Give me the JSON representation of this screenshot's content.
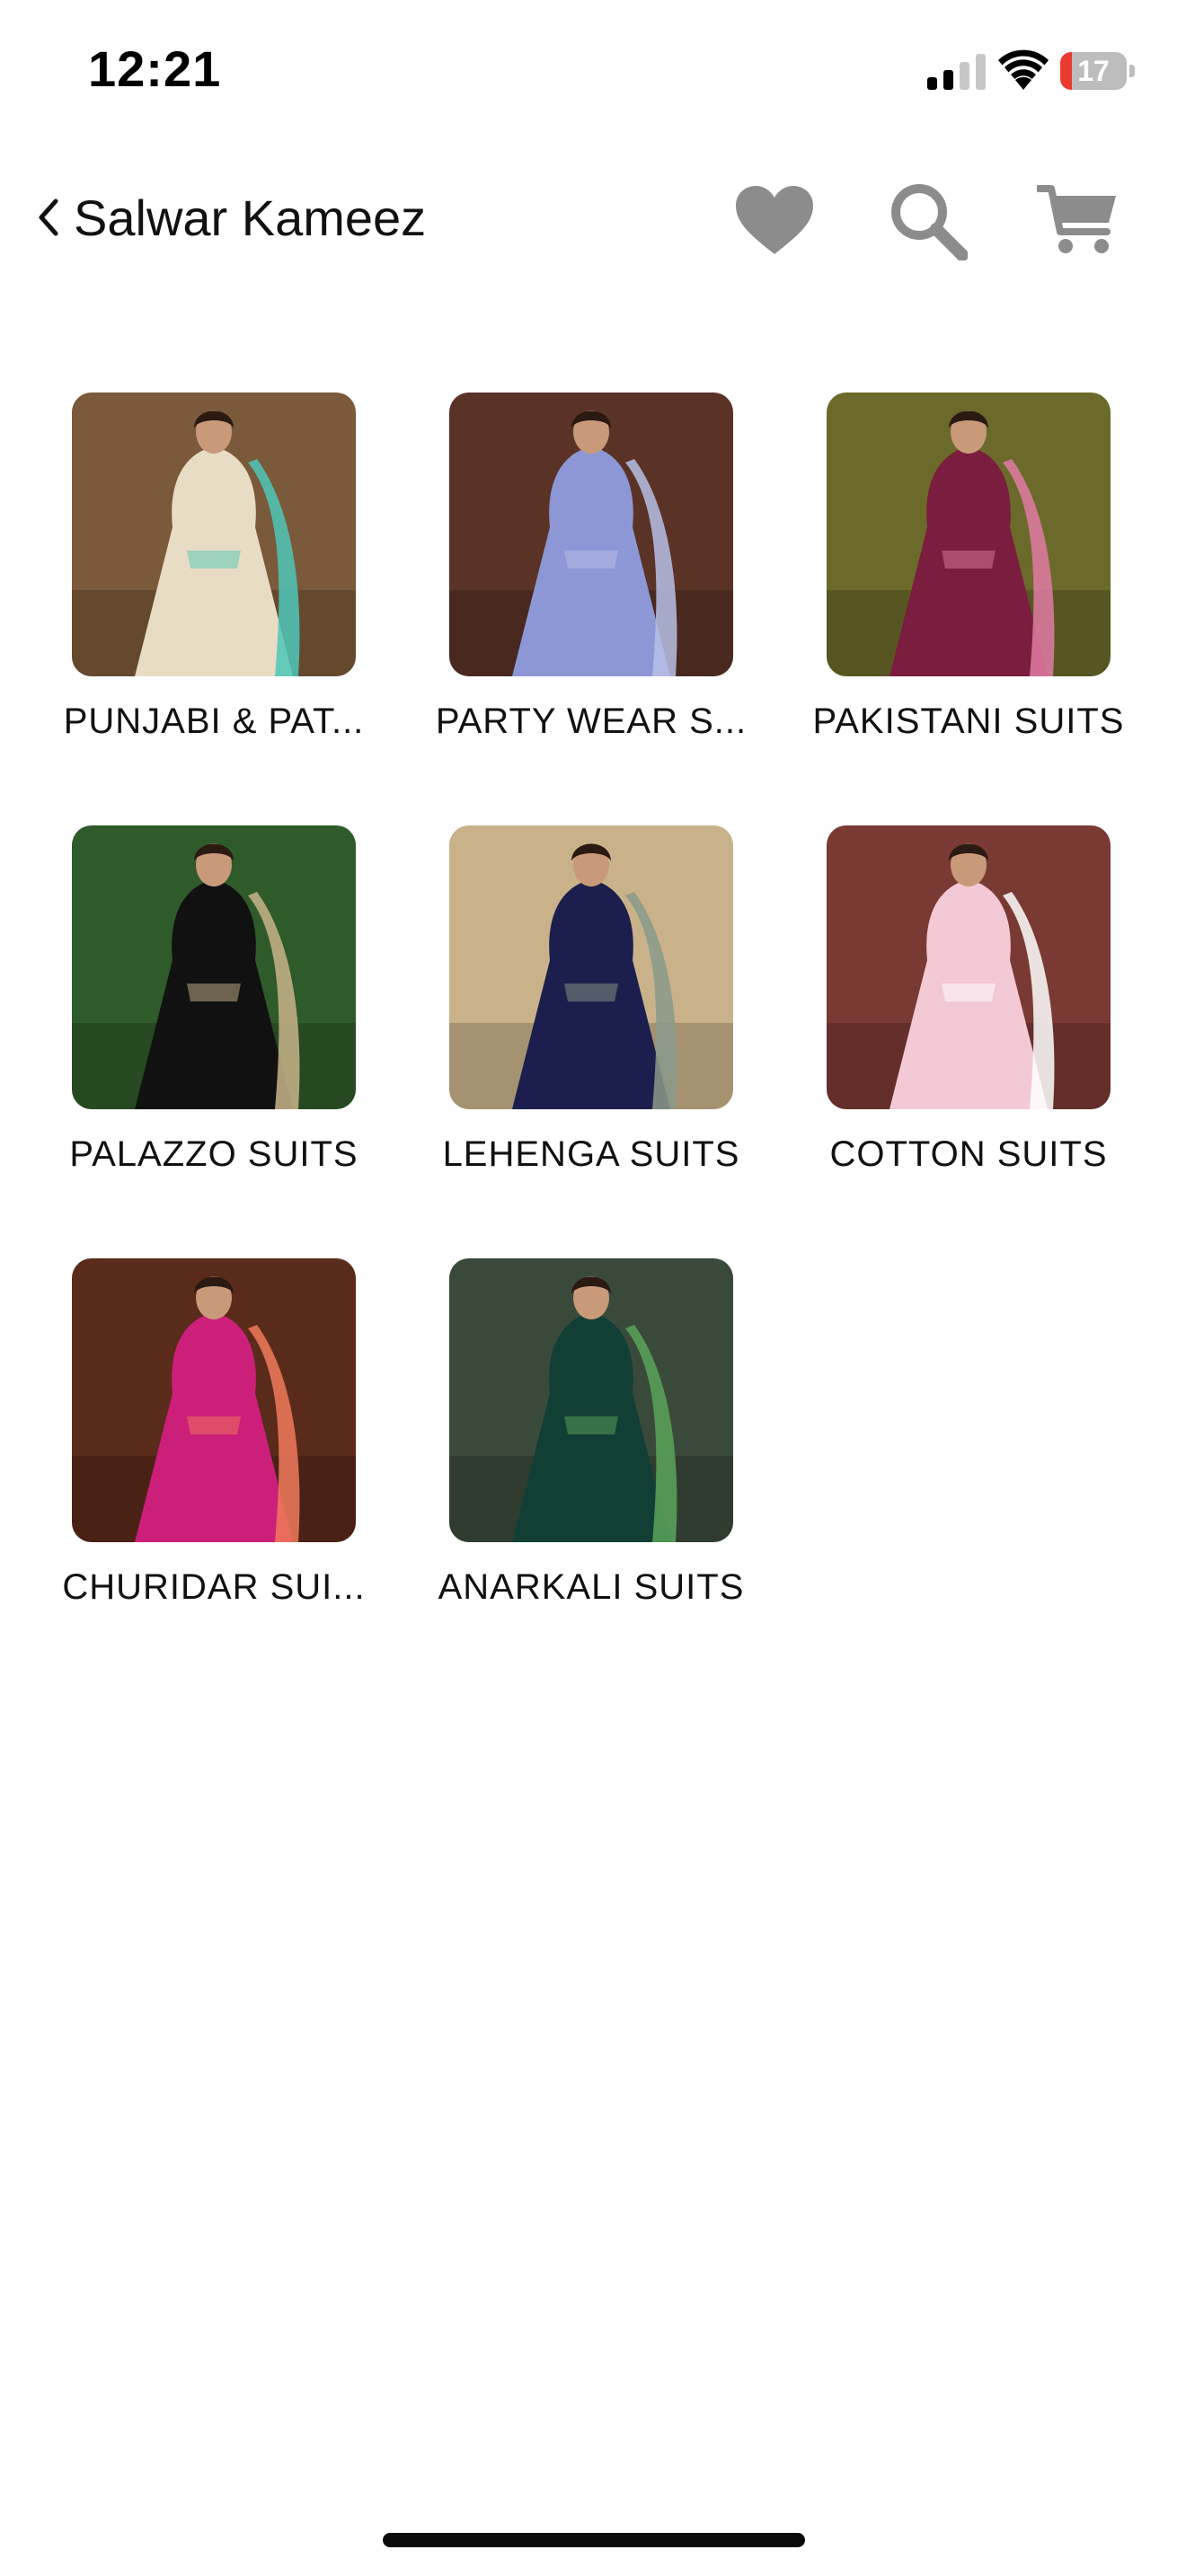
{
  "status_bar": {
    "time": "12:21",
    "battery_level": "17",
    "battery_fraction": 0.17,
    "battery_color": "#ea3a2f",
    "signal_bars_active": 2,
    "signal_bars_total": 4
  },
  "nav": {
    "back_icon": "chevron-left-icon",
    "title": "Salwar Kameez",
    "actions": [
      {
        "name": "wishlist",
        "icon": "heart-icon"
      },
      {
        "name": "search",
        "icon": "search-icon"
      },
      {
        "name": "cart",
        "icon": "cart-icon"
      }
    ],
    "icon_color": "#8c8c8c"
  },
  "categories": [
    {
      "label": "PUNJABI & PAT...",
      "image": "woman in beige kurta with teal salwar and dupatta",
      "bg": "#7a5a3a",
      "dress": "#e9dcc4",
      "accent": "#4fc7b8"
    },
    {
      "label": "PARTY WEAR S...",
      "image": "woman in lavender anarkali gown",
      "bg": "#5a3326",
      "dress": "#8e97d6",
      "accent": "#b7bfe6"
    },
    {
      "label": "PAKISTANI SUITS",
      "image": "woman in maroon embroidered suit in hallway",
      "bg": "#6b6a2a",
      "dress": "#7a1d3e",
      "accent": "#e07aa3"
    },
    {
      "label": "PALAZZO SUITS",
      "image": "woman in black embroidered suit among plants",
      "bg": "#2f5a2a",
      "dress": "#111111",
      "accent": "#c8b48a"
    },
    {
      "label": "LEHENGA SUITS",
      "image": "woman in navy blue suit with grey dupatta",
      "bg": "#c9b28a",
      "dress": "#1c1f4d",
      "accent": "#8a9a8a"
    },
    {
      "label": "COTTON SUITS",
      "image": "woman in pink and white cotton suit",
      "bg": "#7a3a34",
      "dress": "#f3c9d6",
      "accent": "#ffffff"
    },
    {
      "label": "CHURIDAR SUI...",
      "image": "woman in magenta suit with coral dupatta",
      "bg": "#5a2a1a",
      "dress": "#cc1f7a",
      "accent": "#f07a5a"
    },
    {
      "label": "ANARKALI SUITS",
      "image": "woman in dark green anarkali gown",
      "bg": "#3a4a3a",
      "dress": "#123f35",
      "accent": "#5aa35a"
    }
  ]
}
